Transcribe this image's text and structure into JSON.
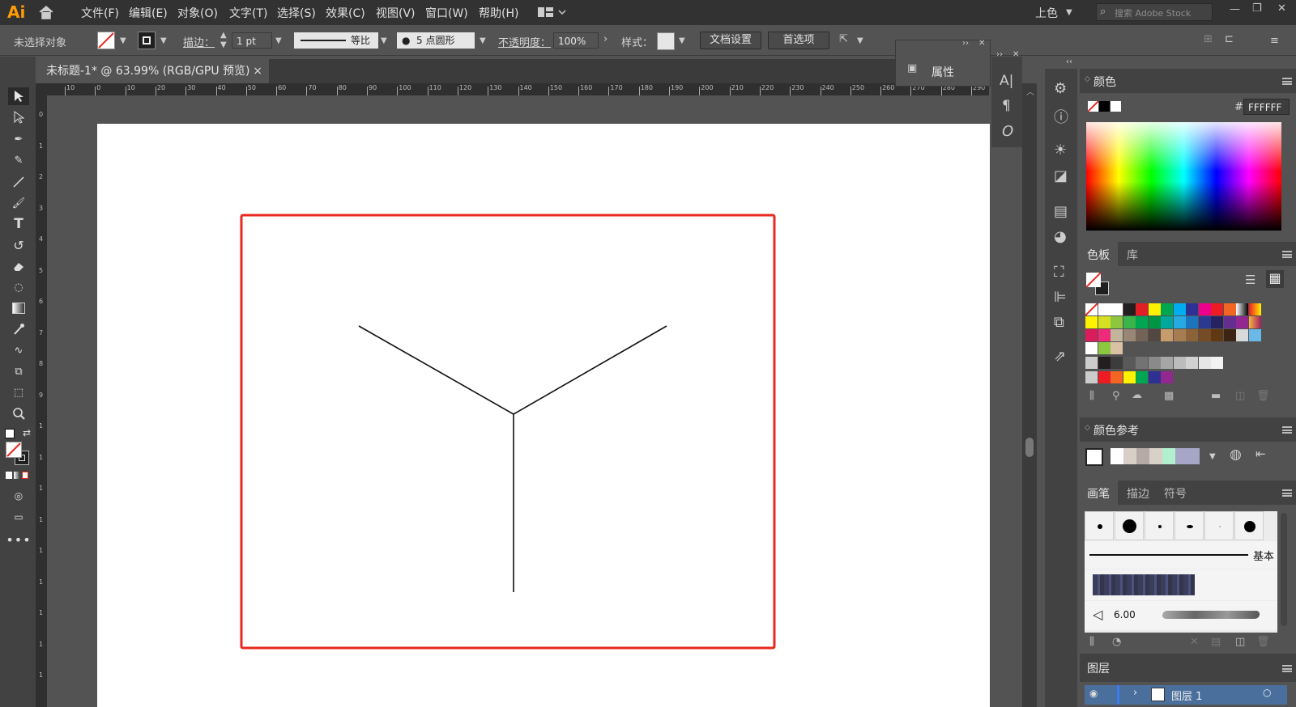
{
  "app": {
    "logo": "Ai",
    "workspace": "上色",
    "search_placeholder": "搜索 Adobe Stock"
  },
  "menu": [
    "文件(F)",
    "编辑(E)",
    "对象(O)",
    "文字(T)",
    "选择(S)",
    "效果(C)",
    "视图(V)",
    "窗口(W)",
    "帮助(H)"
  ],
  "control": {
    "selection": "未选择对象",
    "stroke_label": "描边：",
    "stroke_value": "1 pt",
    "stroke_profile": "等比",
    "brush_label": "5 点圆形",
    "opacity_label": "不透明度：",
    "opacity_value": "100%",
    "style_label": "样式：",
    "doc_setup": "文档设置",
    "prefs": "首选项"
  },
  "document": {
    "tab_title": "未标题-1* @ 63.99% (RGB/GPU 预览)",
    "close": "×"
  },
  "properties_panel": {
    "title": "属性"
  },
  "ruler_h": [
    "10",
    "0",
    "10",
    "20",
    "30",
    "40",
    "50",
    "60",
    "70",
    "80",
    "90",
    "100",
    "110",
    "120",
    "130",
    "140",
    "150",
    "160",
    "170",
    "180",
    "190",
    "200",
    "210",
    "220",
    "230",
    "240",
    "250",
    "260",
    "270",
    "280",
    "290"
  ],
  "ruler_v": [
    "0",
    "1",
    "2",
    "3",
    "4",
    "5",
    "6",
    "7",
    "8",
    "9",
    "1",
    "1",
    "1",
    "1",
    "1",
    "1",
    "1",
    "1",
    "1"
  ],
  "color_panel": {
    "title": "颜色",
    "hex_label": "#",
    "hex": "FFFFFF"
  },
  "swatches_panel": {
    "tabs": [
      "色板",
      "库"
    ]
  },
  "color_guide": {
    "title": "颜色参考"
  },
  "brushes_panel": {
    "tabs": [
      "画笔",
      "描边",
      "符号"
    ],
    "basic_label": "基本",
    "size": "6.00"
  },
  "layers_panel": {
    "title": "图层",
    "layer_name": "图层 1"
  },
  "colors": {
    "highlight_red": "#e8281f",
    "menubar": "#323232",
    "panel": "#535353"
  }
}
